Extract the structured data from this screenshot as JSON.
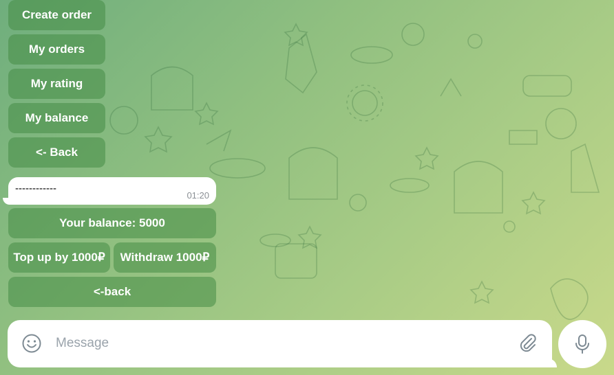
{
  "keyboard_top": {
    "create_order": "Create order",
    "my_orders": "My orders",
    "my_rating": "My rating",
    "my_balance": "My balance",
    "back": "<- Back"
  },
  "message": {
    "text": "------------",
    "time": "01:20"
  },
  "keyboard_balance": {
    "balance": "Your balance: 5000",
    "top_up": "Top up by 1000₽",
    "withdraw": "Withdraw 1000₽",
    "back": "<-back"
  },
  "composer": {
    "placeholder": "Message",
    "emoji_icon": "smile-icon",
    "attach_icon": "paperclip-icon",
    "voice_icon": "microphone-icon"
  }
}
